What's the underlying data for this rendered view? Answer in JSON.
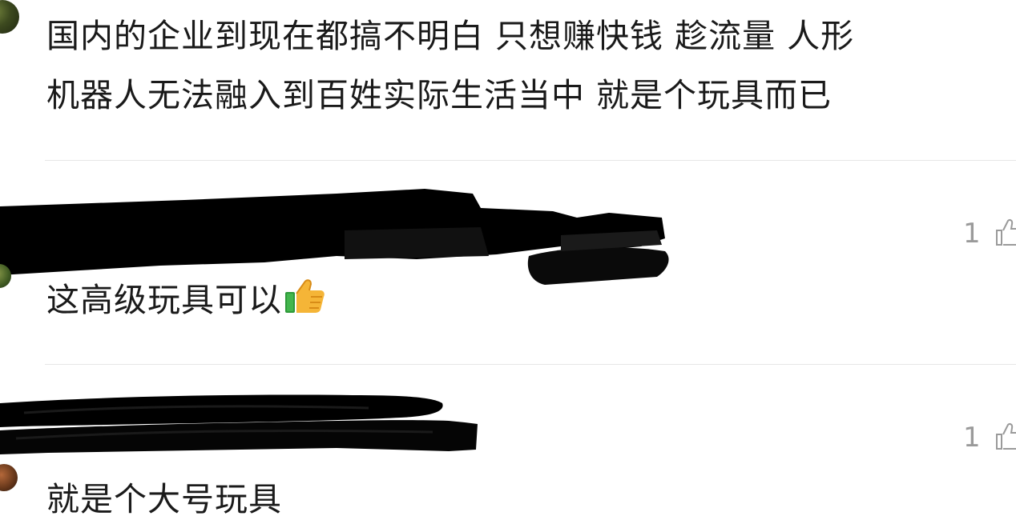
{
  "comments": [
    {
      "text_line1": "国内的企业到现在都搞不明白 只想赚快钱 趁流量 人形",
      "text_line2": "机器人无法融入到百姓实际生活当中 就是个玩具而已"
    },
    {
      "text": "这高级玩具可以",
      "emoji": "thumbs-up-emoji",
      "likes": "1"
    },
    {
      "text": "就是个大号玩具",
      "likes": "1"
    }
  ],
  "icons": {
    "like": "thumbs-up-outline-icon"
  },
  "colors": {
    "text": "#1a1a1a",
    "meta": "#9a9a9a",
    "divider": "#e6e6e6",
    "redaction": "#000000"
  }
}
